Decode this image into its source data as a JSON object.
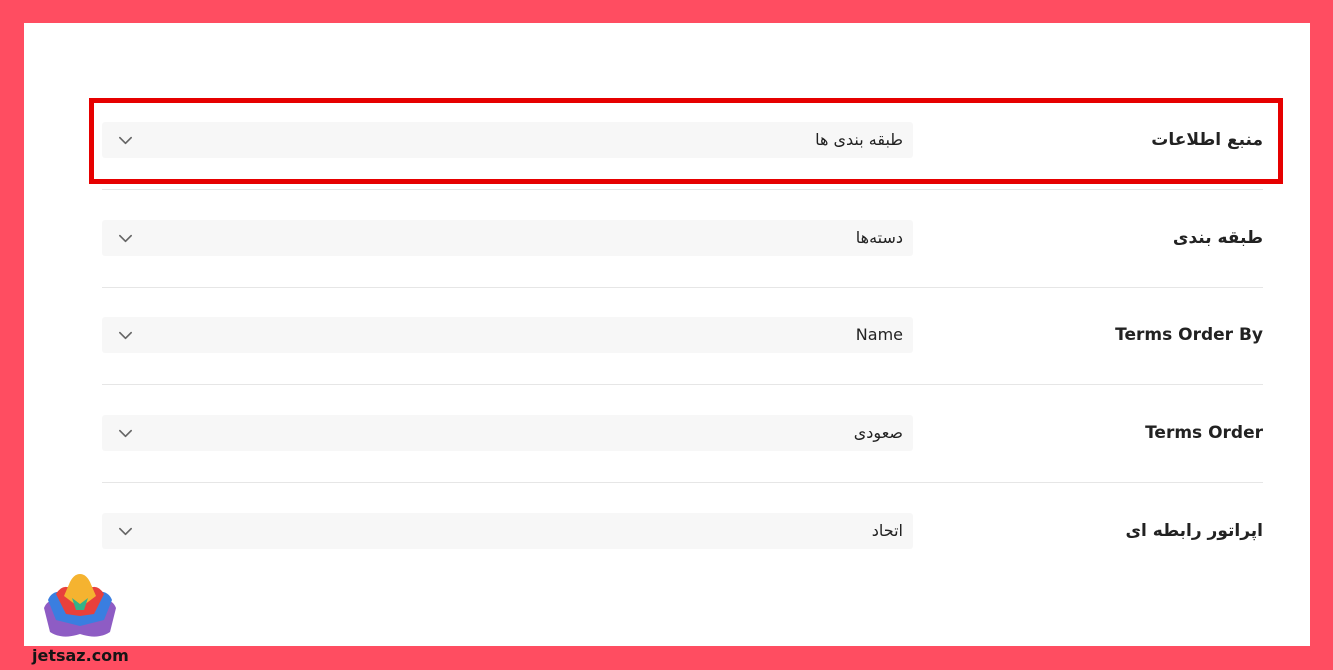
{
  "fields": [
    {
      "label": "منبع اطلاعات",
      "value": "طبقه بندی ها"
    },
    {
      "label": "طبقه بندی",
      "value": "دسته‌ها"
    },
    {
      "label": "Terms Order By",
      "value": "Name"
    },
    {
      "label": "Terms Order",
      "value": "صعودی"
    },
    {
      "label": "اپراتور رابطه ای",
      "value": "اتحاد"
    }
  ],
  "watermark": "jetsaz.com",
  "icons": {
    "dropdown": "chevron-down-icon",
    "logo": "jetsaz-logo-icon"
  },
  "colors": {
    "frame": "#ff4d61",
    "highlight": "#e60000",
    "select_bg": "#f7f7f7",
    "divider": "#e6e6e6"
  }
}
